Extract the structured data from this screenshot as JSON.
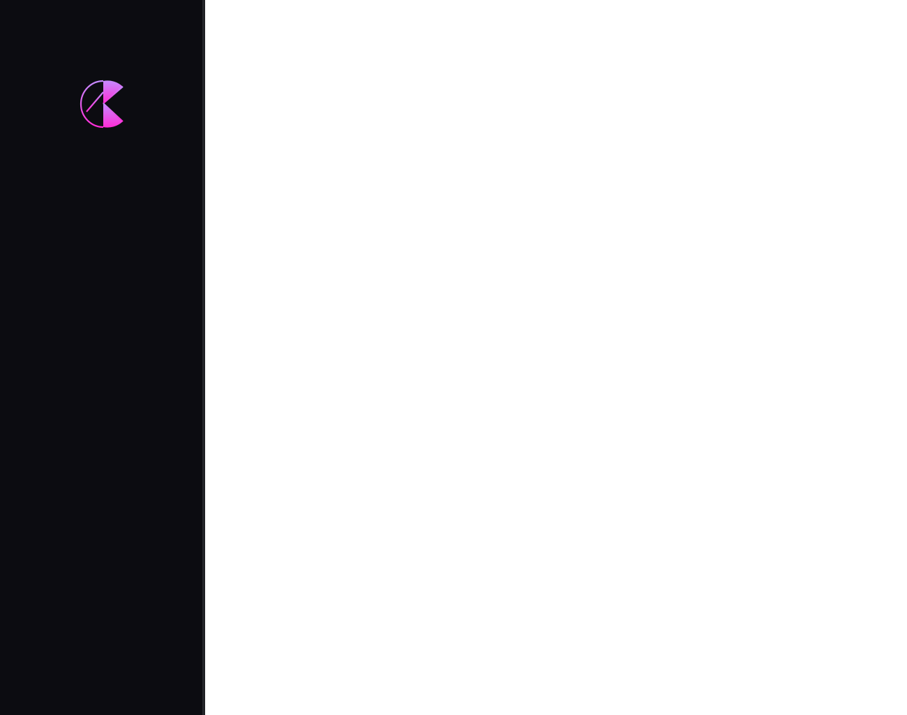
{
  "sidebar": {
    "logo": {
      "icon": "brand-logo-icon",
      "gradient_start": "#c58bff",
      "gradient_end": "#ff2bd6"
    },
    "background": "#0c0c11"
  },
  "main": {
    "background": "#ffffff"
  }
}
